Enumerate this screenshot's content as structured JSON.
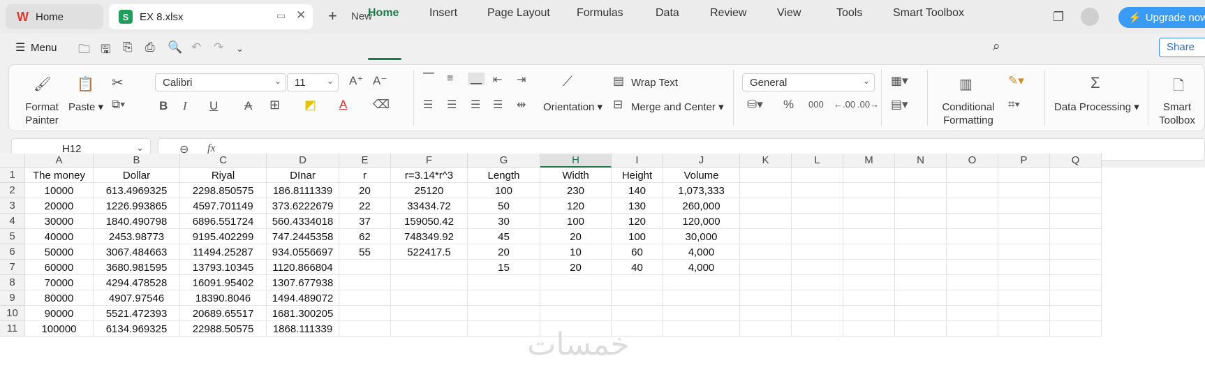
{
  "tabs": {
    "home": "Home",
    "file": "EX 8.xlsx",
    "new": "New",
    "upgrade": "Upgrade now"
  },
  "menu": {
    "label": "Menu",
    "items": [
      "Home",
      "Insert",
      "Page Layout",
      "Formulas",
      "Data",
      "Review",
      "View",
      "Tools",
      "Smart Toolbox"
    ],
    "share": "Share"
  },
  "ribbon": {
    "format_painter": "Format Painter",
    "paste": "Paste",
    "font": "Calibri",
    "size": "11",
    "wrap": "Wrap Text",
    "orientation": "Orientation",
    "merge": "Merge and Center",
    "number_format": "General",
    "conditional": "Conditional Formatting",
    "data_processing": "Data Processing",
    "smart_toolbox": "Smart Toolbox"
  },
  "formula_bar": {
    "cell_ref": "H12",
    "fx": "fx"
  },
  "columns": [
    "A",
    "B",
    "C",
    "D",
    "E",
    "F",
    "G",
    "H",
    "I",
    "J",
    "K",
    "L",
    "M",
    "N",
    "O",
    "P",
    "Q"
  ],
  "rows": [
    "1",
    "2",
    "3",
    "4",
    "5",
    "6",
    "7",
    "8",
    "9",
    "10",
    "11"
  ],
  "cells": [
    [
      "The money",
      "Dollar",
      "Riyal",
      "DInar",
      "r",
      "r=3.14*r^3",
      "Length",
      "Width",
      "Height",
      "Volume",
      "",
      "",
      "",
      "",
      "",
      "",
      ""
    ],
    [
      "10000",
      "613.4969325",
      "2298.850575",
      "186.8111339",
      "20",
      "25120",
      "100",
      "230",
      "140",
      "1,073,333",
      "",
      "",
      "",
      "",
      "",
      "",
      ""
    ],
    [
      "20000",
      "1226.993865",
      "4597.701149",
      "373.6222679",
      "22",
      "33434.72",
      "50",
      "120",
      "130",
      "260,000",
      "",
      "",
      "",
      "",
      "",
      "",
      ""
    ],
    [
      "30000",
      "1840.490798",
      "6896.551724",
      "560.4334018",
      "37",
      "159050.42",
      "30",
      "100",
      "120",
      "120,000",
      "",
      "",
      "",
      "",
      "",
      "",
      ""
    ],
    [
      "40000",
      "2453.98773",
      "9195.402299",
      "747.2445358",
      "62",
      "748349.92",
      "45",
      "20",
      "100",
      "30,000",
      "",
      "",
      "",
      "",
      "",
      "",
      ""
    ],
    [
      "50000",
      "3067.484663",
      "11494.25287",
      "934.0556697",
      "55",
      "522417.5",
      "20",
      "10",
      "60",
      "4,000",
      "",
      "",
      "",
      "",
      "",
      "",
      ""
    ],
    [
      "60000",
      "3680.981595",
      "13793.10345",
      "1120.866804",
      "",
      "",
      "15",
      "20",
      "40",
      "4,000",
      "",
      "",
      "",
      "",
      "",
      "",
      ""
    ],
    [
      "70000",
      "4294.478528",
      "16091.95402",
      "1307.677938",
      "",
      "",
      "",
      "",
      "",
      "",
      "",
      "",
      "",
      "",
      "",
      "",
      ""
    ],
    [
      "80000",
      "4907.97546",
      "18390.8046",
      "1494.489072",
      "",
      "",
      "",
      "",
      "",
      "",
      "",
      "",
      "",
      "",
      "",
      "",
      ""
    ],
    [
      "90000",
      "5521.472393",
      "20689.65517",
      "1681.300205",
      "",
      "",
      "",
      "",
      "",
      "",
      "",
      "",
      "",
      "",
      "",
      "",
      ""
    ],
    [
      "100000",
      "6134.969325",
      "22988.50575",
      "1868.111339",
      "",
      "",
      "",
      "",
      "",
      "",
      "",
      "",
      "",
      "",
      "",
      "",
      ""
    ]
  ],
  "selected_column": "H",
  "watermark": "خمسات"
}
